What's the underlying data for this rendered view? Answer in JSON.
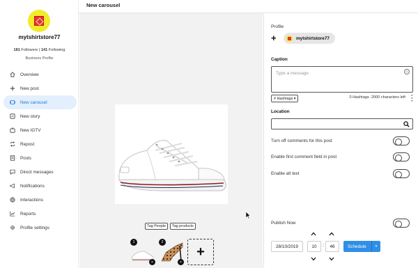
{
  "sidebar": {
    "username": "mytshirtstore77",
    "followers_count": "181",
    "followers_label": "Followers |",
    "following_count": "141",
    "following_label": "Following",
    "account_type": "Business Profile",
    "items": [
      {
        "label": "Overview",
        "icon": "home-icon"
      },
      {
        "label": "New post",
        "icon": "plus-icon"
      },
      {
        "label": "New carousel",
        "icon": "carousel-icon",
        "active": true
      },
      {
        "label": "New story",
        "icon": "story-icon"
      },
      {
        "label": "New IGTV",
        "icon": "tv-icon"
      },
      {
        "label": "Repost",
        "icon": "repost-icon"
      },
      {
        "label": "Posts",
        "icon": "posts-icon"
      },
      {
        "label": "Direct messages",
        "icon": "message-icon"
      },
      {
        "label": "Notifications",
        "icon": "megaphone-icon"
      },
      {
        "label": "Interactions",
        "icon": "globe-icon"
      },
      {
        "label": "Reports",
        "icon": "chart-icon"
      },
      {
        "label": "Profile settings",
        "icon": "gear-icon"
      }
    ]
  },
  "header": {
    "title": "New carousel"
  },
  "preview": {
    "tag_people": "Tag People",
    "tag_products": "Tag products",
    "thumbs": [
      {
        "number": "1",
        "delete": "×"
      },
      {
        "number": "2",
        "delete": "×"
      }
    ],
    "add_label": "+"
  },
  "panel": {
    "profile_label": "Profile",
    "profile_add": "+",
    "profile_name": "mytshirtstore77",
    "caption_label": "Caption",
    "caption_placeholder": "Type a message",
    "hashtags_button": "# Hashtags ▾",
    "hashtag_count": "0 Hashtags",
    "chars_left": "2000 characters left",
    "location_label": "Location",
    "option_comments_off": "Turn off comments for this post",
    "option_first_comment": "Enable first comment field in post",
    "option_alt_text": "Enable alt text",
    "publish_now": "Publish Now",
    "date": "28/10/2019",
    "hour": "10",
    "minute": "46",
    "time_separator": ":",
    "schedule_button": "Schedule"
  },
  "colors": {
    "accent": "#2f8fe6",
    "active_nav_bg": "#e3effc",
    "avatar_yellow": "#f2ea2a",
    "avatar_red": "#e8352b"
  }
}
